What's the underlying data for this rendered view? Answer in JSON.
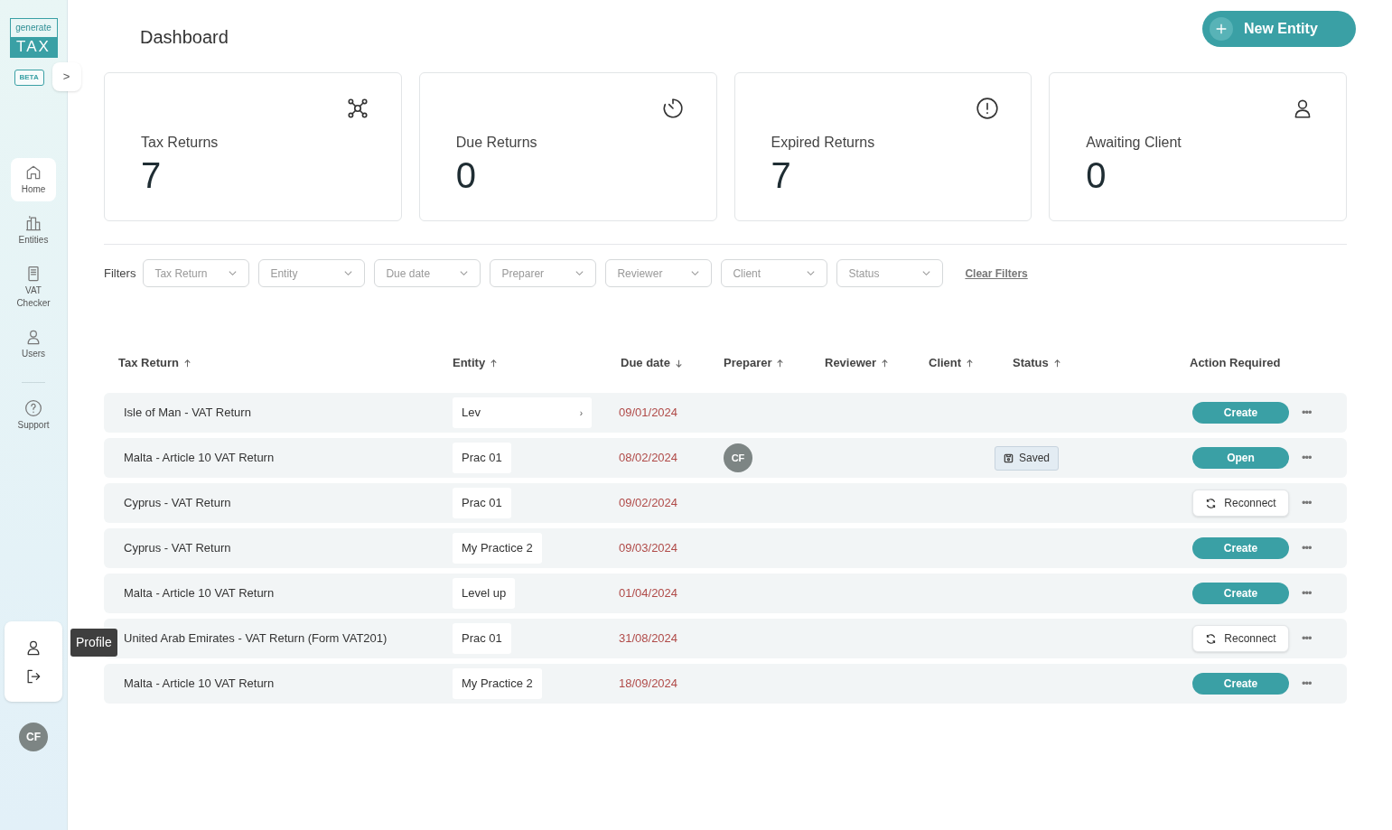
{
  "sidebar": {
    "logo_top": "generate",
    "logo_bottom": "TAX",
    "badge": "BETA",
    "expand": ">",
    "items": [
      {
        "label": "Home",
        "selected": true
      },
      {
        "label": "Entities",
        "selected": false
      },
      {
        "label": "VAT Checker",
        "selected": false
      },
      {
        "label": "Users",
        "selected": false
      }
    ],
    "support": {
      "label": "Support"
    },
    "profile_menu": {
      "tooltip": "Profile"
    },
    "avatar": "CF"
  },
  "header": {
    "title": "Dashboard",
    "new_button": "New Entity"
  },
  "stats": [
    {
      "label": "Tax Returns",
      "value": "7"
    },
    {
      "label": "Due Returns",
      "value": "0"
    },
    {
      "label": "Expired Returns",
      "value": "7"
    },
    {
      "label": "Awaiting Client",
      "value": "0"
    }
  ],
  "filters": {
    "label": "Filters",
    "dropdowns": [
      "Tax Return",
      "Entity",
      "Due date",
      "Preparer",
      "Reviewer",
      "Client",
      "Status"
    ],
    "clear": "Clear Filters"
  },
  "table": {
    "columns": [
      {
        "label": "Tax Return",
        "kind": "ascending"
      },
      {
        "label": "Entity",
        "kind": "ascending"
      },
      {
        "label": "Due date",
        "kind": "descending"
      },
      {
        "label": "Preparer",
        "kind": "ascending"
      },
      {
        "label": "Reviewer",
        "kind": "ascending"
      },
      {
        "label": "Client",
        "kind": "ascending"
      },
      {
        "label": "Status",
        "kind": "ascending"
      },
      {
        "label": "Action Required",
        "kind": "plain"
      }
    ],
    "rows": [
      {
        "tax_return": "Isle of Man - VAT Return",
        "entity": "Lev",
        "entity_marker": "›",
        "due": "09/01/2024",
        "action": {
          "label": "Create",
          "kind": "primary"
        },
        "more": "•••"
      },
      {
        "tax_return": "Malta - Article 10 VAT Return",
        "entity": "Prac 01",
        "due": "08/02/2024",
        "preparer": "CF",
        "status": "Saved",
        "action": {
          "label": "Open",
          "kind": "primary"
        },
        "more": "•••"
      },
      {
        "tax_return": "Cyprus - VAT Return",
        "entity": "Prac 01",
        "due": "09/02/2024",
        "action": {
          "label": "Reconnect",
          "kind": "reconnect"
        },
        "more": "•••"
      },
      {
        "tax_return": "Cyprus - VAT Return",
        "entity": "My Practice 2",
        "due": "09/03/2024",
        "action": {
          "label": "Create",
          "kind": "primary"
        },
        "more": "•••"
      },
      {
        "tax_return": "Malta - Article 10 VAT Return",
        "entity": "Level up",
        "due": "01/04/2024",
        "action": {
          "label": "Create",
          "kind": "primary"
        },
        "more": "•••"
      },
      {
        "tax_return": "United Arab Emirates - VAT Return (Form VAT201)",
        "entity": "Prac 01",
        "due": "31/08/2024",
        "action": {
          "label": "Reconnect",
          "kind": "reconnect"
        },
        "more": "•••"
      },
      {
        "tax_return": "Malta - Article 10 VAT Return",
        "entity": "My Practice 2",
        "due": "18/09/2024",
        "action": {
          "label": "Create",
          "kind": "primary"
        },
        "more": "•••"
      }
    ]
  }
}
